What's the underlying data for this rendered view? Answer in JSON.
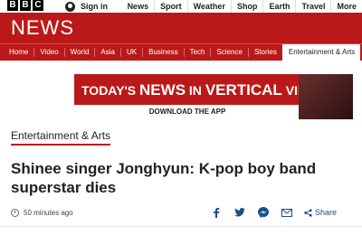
{
  "branding": {
    "bbc_letters": [
      "B",
      "B",
      "C"
    ],
    "news_title": "NEWS"
  },
  "topbar": {
    "signin_label": "Sign in",
    "nav": [
      "News",
      "Sport",
      "Weather",
      "Shop",
      "Earth",
      "Travel",
      "More"
    ]
  },
  "section_nav": {
    "items": [
      "Home",
      "Video",
      "World",
      "Asia",
      "UK",
      "Business",
      "Tech",
      "Science",
      "Stories",
      "Entertainment & Arts"
    ],
    "active_index": 9
  },
  "ad": {
    "text_part1": "TODAY'S ",
    "text_part2": "NEWS",
    "text_part3": " IN ",
    "text_part4": "VERTICAL",
    "text_part5": " VIDEO",
    "cta": "DOWNLOAD THE APP"
  },
  "article": {
    "section": "Entertainment & Arts",
    "headline": "Shinee singer Jonghyun: K-pop boy band superstar dies",
    "timestamp": "50 minutes ago"
  },
  "share": {
    "label": "Share",
    "icons": [
      "facebook-icon",
      "twitter-icon",
      "messenger-icon",
      "email-icon",
      "share-icon"
    ]
  },
  "colors": {
    "brand_red": "#bb1919",
    "link_blue": "#1a4f8b"
  }
}
